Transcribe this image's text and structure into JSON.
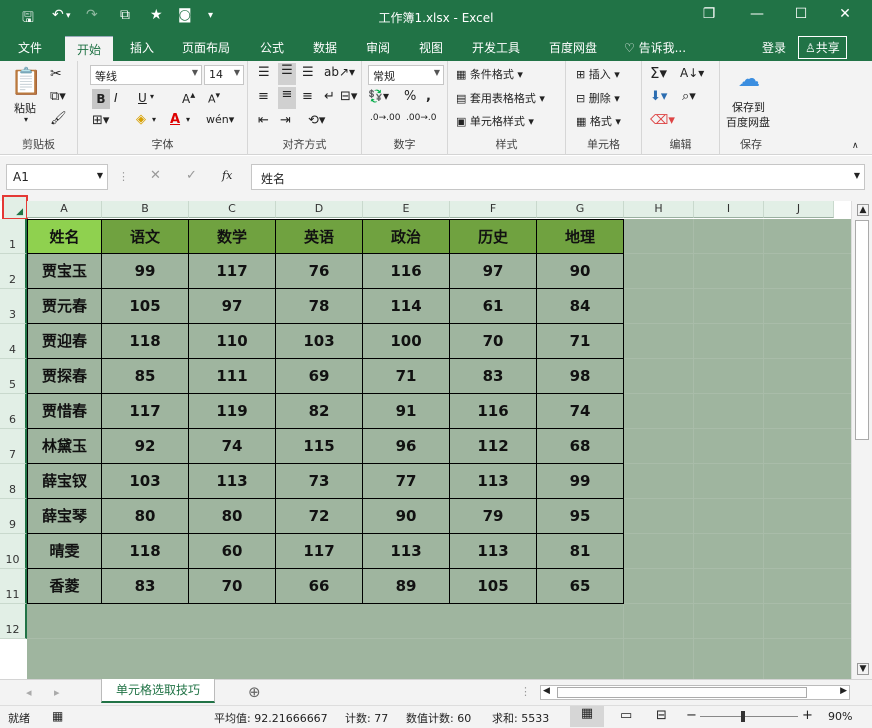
{
  "window": {
    "title": "工作簿1.xlsx - Excel",
    "controls": [
      "❐",
      "—",
      "☐",
      "✕"
    ]
  },
  "tabs": [
    "文件",
    "开始",
    "插入",
    "页面布局",
    "公式",
    "数据",
    "审阅",
    "视图",
    "开发工具",
    "百度网盘",
    "告诉我...",
    "登录",
    "共享"
  ],
  "ribbon": {
    "font_name": "等线",
    "font_size": "14",
    "number_format": "常规",
    "groups": [
      "剪贴板",
      "字体",
      "对齐方式",
      "数字",
      "样式",
      "单元格",
      "编辑",
      "保存"
    ],
    "paste": "粘贴",
    "cond_format": "条件格式",
    "table_format": "套用表格格式",
    "cell_style": "单元格样式",
    "insert": "插入",
    "delete": "删除",
    "format": "格式",
    "save_baidu": [
      "保存到",
      "百度网盘"
    ],
    "bold": "B",
    "italic": "I",
    "underline": "U"
  },
  "formula_bar": {
    "name_box": "A1",
    "fx": "fx",
    "content": "姓名"
  },
  "columns": [
    "A",
    "B",
    "C",
    "D",
    "E",
    "F",
    "G",
    "H",
    "I",
    "J"
  ],
  "rows": [
    "1",
    "2",
    "3",
    "4",
    "5",
    "6",
    "7",
    "8",
    "9",
    "10",
    "11",
    "12"
  ],
  "table": {
    "headers": [
      "姓名",
      "语文",
      "数学",
      "英语",
      "政治",
      "历史",
      "地理"
    ],
    "data": [
      [
        "贾宝玉",
        "99",
        "117",
        "76",
        "116",
        "97",
        "90"
      ],
      [
        "贾元春",
        "105",
        "97",
        "78",
        "114",
        "61",
        "84"
      ],
      [
        "贾迎春",
        "118",
        "110",
        "103",
        "100",
        "70",
        "71"
      ],
      [
        "贾探春",
        "85",
        "111",
        "69",
        "71",
        "83",
        "98"
      ],
      [
        "贾惜春",
        "117",
        "119",
        "82",
        "91",
        "116",
        "74"
      ],
      [
        "林黛玉",
        "92",
        "74",
        "115",
        "96",
        "112",
        "68"
      ],
      [
        "薛宝钗",
        "103",
        "113",
        "73",
        "77",
        "113",
        "99"
      ],
      [
        "薛宝琴",
        "80",
        "80",
        "72",
        "90",
        "79",
        "95"
      ],
      [
        "晴雯",
        "118",
        "60",
        "117",
        "113",
        "113",
        "81"
      ],
      [
        "香菱",
        "83",
        "70",
        "66",
        "89",
        "105",
        "65"
      ]
    ]
  },
  "sheet_tab": "单元格选取技巧",
  "status": {
    "ready": "就绪",
    "average": "平均值: 92.21666667",
    "count": "计数: 77",
    "numcount": "数值计数: 60",
    "sum": "求和: 5533",
    "zoom": "90%"
  }
}
